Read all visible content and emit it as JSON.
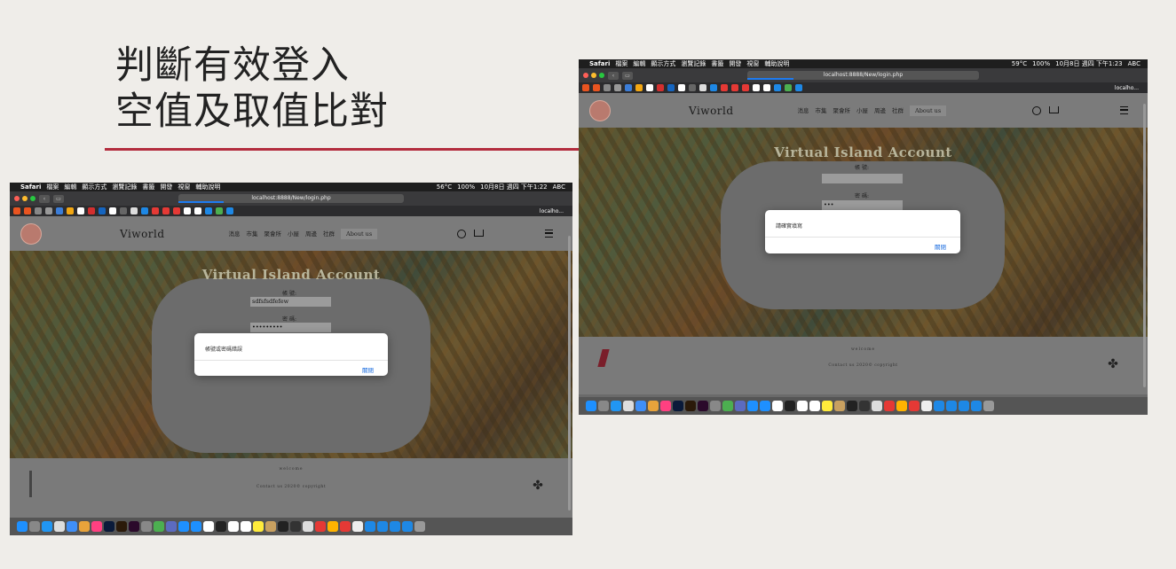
{
  "slide": {
    "title_line1": "判斷有效登入",
    "title_line2": "空值及取值比對",
    "accent_color": "#b32c3d"
  },
  "screens": [
    {
      "menubar": {
        "apple": "",
        "app": "Safari",
        "items": [
          "檔案",
          "編輯",
          "顯示方式",
          "瀏覽記錄",
          "書籤",
          "開發",
          "視窗",
          "輔助說明"
        ],
        "temp": "56°C",
        "battery": "100%",
        "datetime": "10月8日 週四 下午1:22",
        "input": "ABC"
      },
      "url": "localhost:8888/New/login.php",
      "bookmark_label": "localho...",
      "site": {
        "name": "Viworld",
        "nav": [
          "消息",
          "市集",
          "聚會所",
          "小屋",
          "周邊",
          "社群",
          "About us"
        ],
        "hero_title": "Virtual Island Account",
        "account_label": "帳 號:",
        "account_value": "sdfsfsdfefew",
        "password_label": "密 碼:",
        "password_value": "•••••••••",
        "footer_welcome": "welcome",
        "footer_contact": "Contact us 2020© copyright"
      },
      "alert": {
        "message": "帳號或密碼錯誤",
        "button": "關閉"
      }
    },
    {
      "menubar": {
        "apple": "",
        "app": "Safari",
        "items": [
          "檔案",
          "編輯",
          "顯示方式",
          "瀏覽記錄",
          "書籤",
          "開發",
          "視窗",
          "輔助說明"
        ],
        "temp": "59°C",
        "battery": "100%",
        "datetime": "10月8日 週四 下午1:23",
        "input": "ABC"
      },
      "url": "localhost:8888/New/login.php",
      "bookmark_label": "localho...",
      "site": {
        "name": "Viworld",
        "nav": [
          "消息",
          "市集",
          "聚會所",
          "小屋",
          "周邊",
          "社群",
          "About us"
        ],
        "hero_title": "Virtual Island Account",
        "account_label": "帳 號:",
        "account_value": "",
        "password_label": "密 碼:",
        "password_value": "•••",
        "footer_welcome": "welcome",
        "footer_contact": "Contact us 2020© copyright"
      },
      "alert": {
        "message": "請確實填寫",
        "button": "關閉"
      }
    }
  ]
}
